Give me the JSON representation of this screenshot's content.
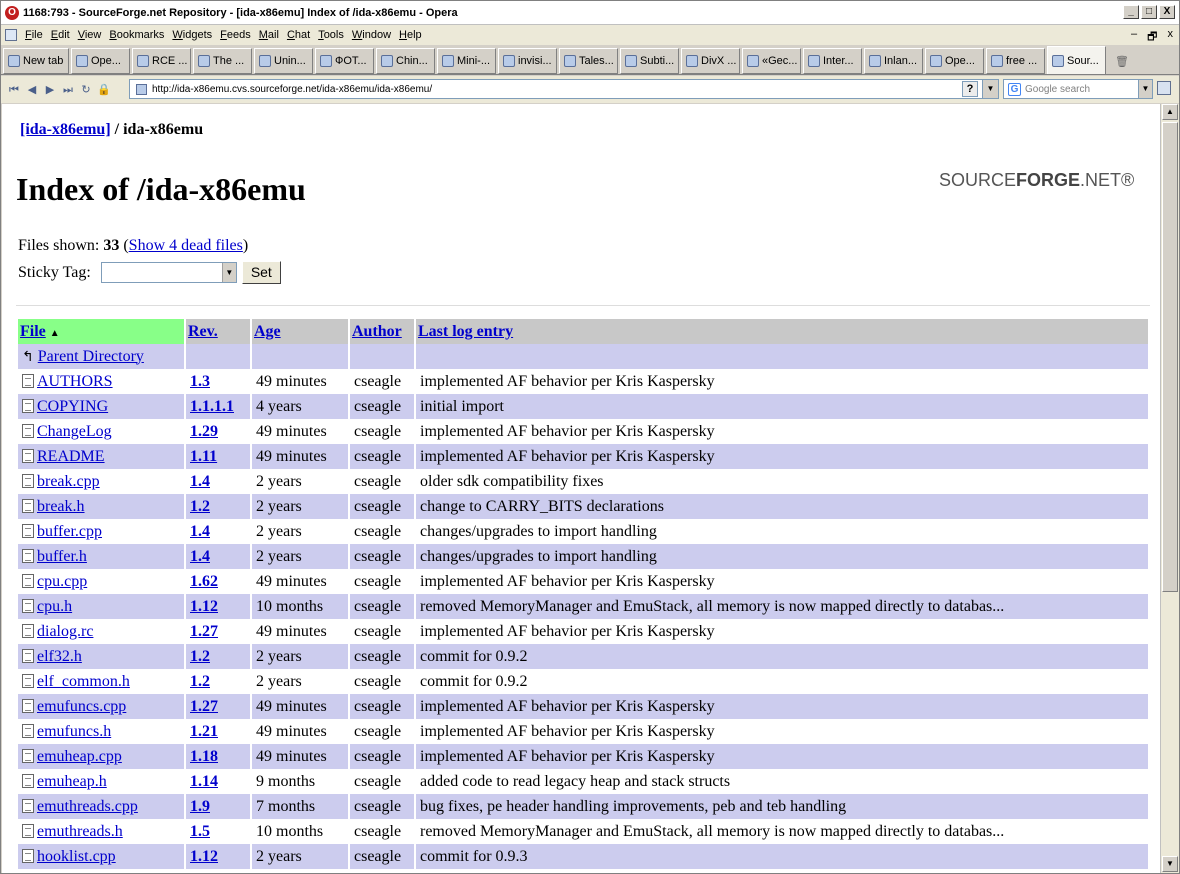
{
  "window": {
    "title": "1168:793 - SourceForge.net Repository - [ida-x86emu] Index of /ida-x86emu - Opera",
    "minimize": "_",
    "maximize": "□",
    "close": "X"
  },
  "menubar": {
    "items": [
      "File",
      "Edit",
      "View",
      "Bookmarks",
      "Widgets",
      "Feeds",
      "Mail",
      "Chat",
      "Tools",
      "Window",
      "Help"
    ],
    "mdi_min": "‒",
    "mdi_restore": "🗗",
    "mdi_close": "x"
  },
  "tabs": [
    {
      "label": "New tab",
      "icon": "new-tab-icon"
    },
    {
      "label": "Ope...",
      "icon": "opera-icon"
    },
    {
      "label": "RCE ...",
      "icon": "rce-icon"
    },
    {
      "label": "The ...",
      "icon": "page-icon"
    },
    {
      "label": "Unin...",
      "icon": "page-icon"
    },
    {
      "label": "ФОТ...",
      "icon": "photo-icon"
    },
    {
      "label": "Chin...",
      "icon": "wikipedia-icon"
    },
    {
      "label": "Mini-...",
      "icon": "blogger-icon"
    },
    {
      "label": "invisi...",
      "icon": "page-icon"
    },
    {
      "label": "Tales...",
      "icon": "page-icon"
    },
    {
      "label": "Subti...",
      "icon": "subtitle-icon"
    },
    {
      "label": "DivX ...",
      "icon": "divx-icon"
    },
    {
      "label": "«Gec...",
      "icon": "page-icon"
    },
    {
      "label": "Inter...",
      "icon": "page-icon"
    },
    {
      "label": "Inlan...",
      "icon": "wikipedia-icon"
    },
    {
      "label": "Ope...",
      "icon": "opera-icon"
    },
    {
      "label": "free ...",
      "icon": "wordpress-icon"
    },
    {
      "label": "Sour...",
      "icon": "page-icon",
      "active": true
    }
  ],
  "address": {
    "url": "http://ida-x86emu.cvs.sourceforge.net/ida-x86emu/ida-x86emu/",
    "help_glyph": "?",
    "search_placeholder": "Google search"
  },
  "page": {
    "breadcrumb_link": "[ida-x86emu]",
    "breadcrumb_sep": "/",
    "breadcrumb_current": "ida-x86emu",
    "heading": "Index of /ida-x86emu",
    "logo_pre": "SOURCE",
    "logo_bold": "FORGE",
    "logo_post": ".NET®",
    "files_shown_label": "Files shown:",
    "files_shown_count": "33",
    "dead_files_link": "Show 4 dead files",
    "sticky_tag_label": "Sticky Tag:",
    "set_button": "Set"
  },
  "table": {
    "headers": {
      "file": "File",
      "rev": "Rev.",
      "age": "Age",
      "author": "Author",
      "log": "Last log entry"
    },
    "parent": "Parent Directory",
    "rows": [
      {
        "file": "AUTHORS",
        "rev": "1.3",
        "age": "49 minutes",
        "author": "cseagle",
        "log": "implemented AF behavior per Kris Kaspersky"
      },
      {
        "file": "COPYING",
        "rev": "1.1.1.1",
        "age": "4 years",
        "author": "cseagle",
        "log": "initial import"
      },
      {
        "file": "ChangeLog",
        "rev": "1.29",
        "age": "49 minutes",
        "author": "cseagle",
        "log": "implemented AF behavior per Kris Kaspersky"
      },
      {
        "file": "README",
        "rev": "1.11",
        "age": "49 minutes",
        "author": "cseagle",
        "log": "implemented AF behavior per Kris Kaspersky"
      },
      {
        "file": "break.cpp",
        "rev": "1.4",
        "age": "2 years",
        "author": "cseagle",
        "log": "older sdk compatibility fixes"
      },
      {
        "file": "break.h",
        "rev": "1.2",
        "age": "2 years",
        "author": "cseagle",
        "log": "change to CARRY_BITS declarations"
      },
      {
        "file": "buffer.cpp",
        "rev": "1.4",
        "age": "2 years",
        "author": "cseagle",
        "log": "changes/upgrades to import handling"
      },
      {
        "file": "buffer.h",
        "rev": "1.4",
        "age": "2 years",
        "author": "cseagle",
        "log": "changes/upgrades to import handling"
      },
      {
        "file": "cpu.cpp",
        "rev": "1.62",
        "age": "49 minutes",
        "author": "cseagle",
        "log": "implemented AF behavior per Kris Kaspersky"
      },
      {
        "file": "cpu.h",
        "rev": "1.12",
        "age": "10 months",
        "author": "cseagle",
        "log": "removed MemoryManager and EmuStack, all memory is now mapped directly to databas..."
      },
      {
        "file": "dialog.rc",
        "rev": "1.27",
        "age": "49 minutes",
        "author": "cseagle",
        "log": "implemented AF behavior per Kris Kaspersky"
      },
      {
        "file": "elf32.h",
        "rev": "1.2",
        "age": "2 years",
        "author": "cseagle",
        "log": "commit for 0.9.2"
      },
      {
        "file": "elf_common.h",
        "rev": "1.2",
        "age": "2 years",
        "author": "cseagle",
        "log": "commit for 0.9.2"
      },
      {
        "file": "emufuncs.cpp",
        "rev": "1.27",
        "age": "49 minutes",
        "author": "cseagle",
        "log": "implemented AF behavior per Kris Kaspersky"
      },
      {
        "file": "emufuncs.h",
        "rev": "1.21",
        "age": "49 minutes",
        "author": "cseagle",
        "log": "implemented AF behavior per Kris Kaspersky"
      },
      {
        "file": "emuheap.cpp",
        "rev": "1.18",
        "age": "49 minutes",
        "author": "cseagle",
        "log": "implemented AF behavior per Kris Kaspersky"
      },
      {
        "file": "emuheap.h",
        "rev": "1.14",
        "age": "9 months",
        "author": "cseagle",
        "log": "added code to read legacy heap and stack structs"
      },
      {
        "file": "emuthreads.cpp",
        "rev": "1.9",
        "age": "7 months",
        "author": "cseagle",
        "log": "bug fixes, pe header handling improvements, peb and teb handling"
      },
      {
        "file": "emuthreads.h",
        "rev": "1.5",
        "age": "10 months",
        "author": "cseagle",
        "log": "removed MemoryManager and EmuStack, all memory is now mapped directly to databas..."
      },
      {
        "file": "hooklist.cpp",
        "rev": "1.12",
        "age": "2 years",
        "author": "cseagle",
        "log": "commit for 0.9.3"
      }
    ]
  },
  "colors": {
    "row_odd": "#ccccee",
    "row_even": "#ffffff",
    "header_bg": "#c8c8c8",
    "sorted_header_bg": "#88ff88",
    "link": "#0000cc"
  }
}
